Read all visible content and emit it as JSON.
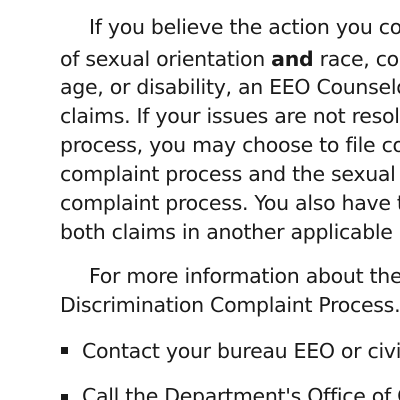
{
  "paragraph1": {
    "line1": "If you believe the action you com",
    "line2_before": "of sexual orientation ",
    "line2_bold": "and",
    "line2_after": " race, colo",
    "line3": "age, or disability, an EEO Counselor",
    "line4": "claims. If your issues are not resolve",
    "line5": "process, you may choose to file co",
    "line6": "complaint process and the sexual o",
    "line7": "complaint process. You also have th",
    "line8": "both claims in another applicable p"
  },
  "paragraph2": {
    "line1": "For more information about the S",
    "line2": "Discrimination Complaint Process."
  },
  "bullets": [
    "Contact your bureau EEO or civil",
    "Call the Department's Office of C"
  ]
}
